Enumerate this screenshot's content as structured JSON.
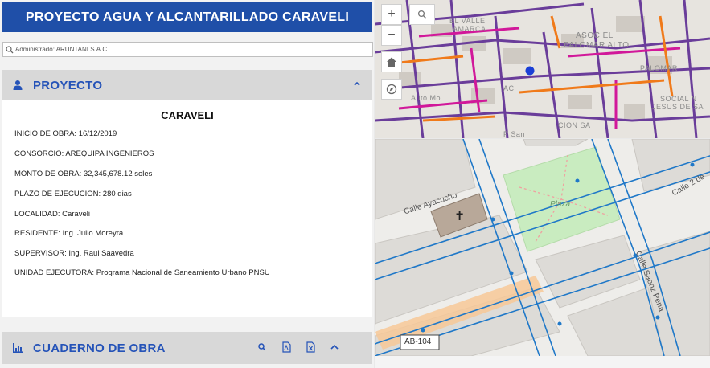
{
  "header": {
    "title": "PROYECTO AGUA Y ALCANTARILLADO CARAVELI"
  },
  "search": {
    "text": "Administrado: ARUNTANI S.A.C."
  },
  "project": {
    "section_title": "PROYECTO",
    "name": "CARAVELI",
    "fields": [
      "INICIO DE OBRA:  16/12/2019",
      "CONSORCIO: AREQUIPA INGENIEROS",
      "MONTO DE OBRA: 32,345,678.12 soles",
      "PLAZO DE EJECUCION: 280 dias",
      "LOCALIDAD: Caraveli",
      "RESIDENTE: Ing. Julio Moreyra",
      "SUPERVISOR: Ing. Raul Saavedra",
      "UNIDAD EJECUTORA: Programa Nacional de Saneamiento Urbano PNSU"
    ]
  },
  "cuaderno": {
    "section_title": "CUADERNO DE OBRA"
  },
  "map_top": {
    "zoom_in": "+",
    "zoom_out": "−",
    "labels": {
      "valle": "EL VALLE",
      "amarca": "AMARCA",
      "asoc_line1": "ASOC EL",
      "asoc_line2": "PALOMAR ALTO",
      "paloma": "PALOMAR",
      "auto": "Auto Mo",
      "social_line1": "SOCIAL N",
      "social_line2": "JESUS DE SA",
      "cion": "CION SA",
      "ac": "AC",
      "san": "P San"
    },
    "colors": {
      "pipe_purple": "#6a3d9a",
      "pipe_magenta": "#d1189a",
      "pipe_orange": "#f07a1a",
      "location": "#1a3fd6"
    }
  },
  "map_bottom": {
    "labels": {
      "ayacucho": "Calle Ayacucho",
      "plaza": "Plaza",
      "calle2": "Calle 2 de",
      "saenz": "Calle Saenz Pena",
      "ab": "AB-104"
    },
    "colors": {
      "plaza": "#c9ecc0",
      "pipe_blue": "#1f78c8",
      "highlight": "#f7c898"
    }
  }
}
